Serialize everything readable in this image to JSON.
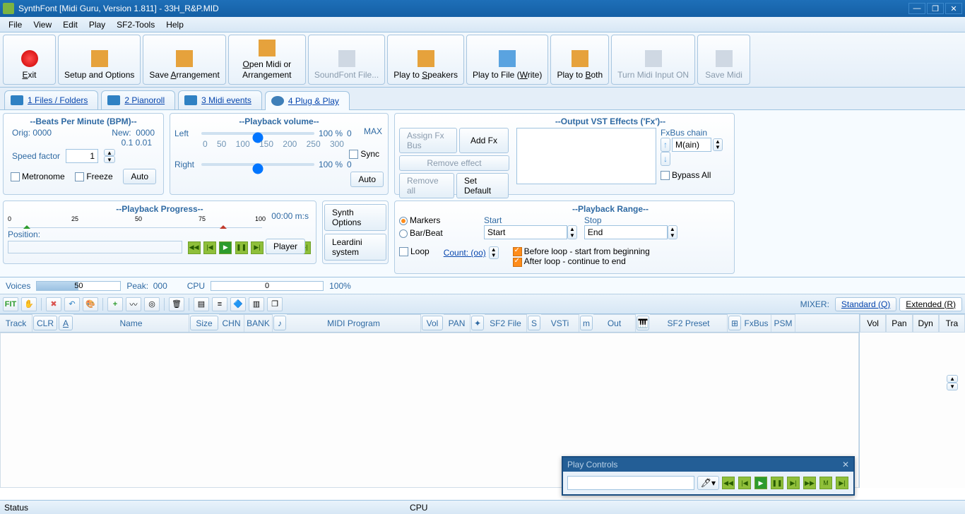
{
  "window": {
    "title": "SynthFont [Midi Guru, Version 1.811] - 33H_R&P.MID"
  },
  "menu": [
    "File",
    "View",
    "Edit",
    "Play",
    "SF2-Tools",
    "Help"
  ],
  "toolbar": {
    "exit": "Exit",
    "setup": "Setup and Options",
    "savearr": "Save Arrangement",
    "openmidi": "Open Midi or Arrangement",
    "sffile": "SoundFont File...",
    "speakers": "Play to Speakers",
    "tofile": "Play to File (Write)",
    "both": "Play to Both",
    "midiin": "Turn Midi Input ON",
    "savemidi": "Save Midi"
  },
  "tabs": {
    "t1": "Files / Folders",
    "t2": "Pianoroll",
    "t3": "Midi events",
    "t4": "Plug & Play",
    "n1": "1",
    "n2": "2",
    "n3": "3",
    "n4": "4"
  },
  "bpm": {
    "title": "--Beats Per Minute (BPM)--",
    "orig": "Orig:",
    "origv": "0000",
    "newlbl": "New:",
    "newv": "0000",
    "fine": "0.1 0.01",
    "speed": "Speed factor",
    "speedv": "1",
    "metronome": "Metronome",
    "freeze": "Freeze",
    "auto": "Auto"
  },
  "pbvol": {
    "title": "--Playback volume--",
    "left": "Left",
    "right": "Right",
    "max": "MAX",
    "pct": "100 %",
    "zero": "0",
    "sync": "Sync",
    "auto": "Auto",
    "ticks": [
      "0",
      "50",
      "100",
      "150",
      "200",
      "250",
      "300"
    ]
  },
  "vst": {
    "title": "--Output VST Effects ('Fx')--",
    "assign": "Assign Fx Bus",
    "add": "Add Fx",
    "remove": "Remove effect",
    "removeall": "Remove all",
    "setdefault": "Set Default",
    "fxbus": "FxBus chain",
    "main": "M(ain)",
    "bypass": "Bypass All"
  },
  "progress": {
    "title": "--Playback Progress--",
    "time": "00:00 m:s",
    "position": "Position:",
    "t0": "0",
    "t25": "25",
    "t50": "50",
    "t75": "75",
    "t100": "100"
  },
  "mid": {
    "synth": "Synth Options",
    "player": "Player",
    "leardini": "Leardini system"
  },
  "range": {
    "title": "--Playback Range--",
    "markers": "Markers",
    "barbeat": "Bar/Beat",
    "startlbl": "Start",
    "stoplbl": "Stop",
    "startv": "Start",
    "endv": "End",
    "loop": "Loop",
    "count": "Count: (oo)",
    "before": "Before loop - start from beginning",
    "after": "After loop - continue to end"
  },
  "voices": {
    "label": "Voices",
    "val": "50",
    "peak": "Peak:",
    "peakv": "000",
    "cpu": "CPU",
    "cpuv": "0",
    "pct": "100%"
  },
  "iconbar": {
    "fit": "FIT"
  },
  "mixer": {
    "label": "MIXER:",
    "standard": "Standard (Q)",
    "extended": "Extended (R)"
  },
  "cols": {
    "track": "Track",
    "clr": "CLR",
    "name": "Name",
    "size": "Size",
    "chn": "CHN",
    "bank": "BANK",
    "midiprog": "MIDI Program",
    "vol": "Vol",
    "pan": "PAN",
    "sf2file": "SF2 File",
    "vsti": "VSTi",
    "out": "Out",
    "sf2preset": "SF2 Preset",
    "fxbus": "FxBus",
    "psm": "PSM"
  },
  "mixcols": {
    "vol": "Vol",
    "pan": "Pan",
    "dyn": "Dyn",
    "tra": "Tra"
  },
  "floatwin": {
    "title": "Play Controls"
  },
  "status": {
    "status": "Status",
    "cpu": "CPU"
  }
}
